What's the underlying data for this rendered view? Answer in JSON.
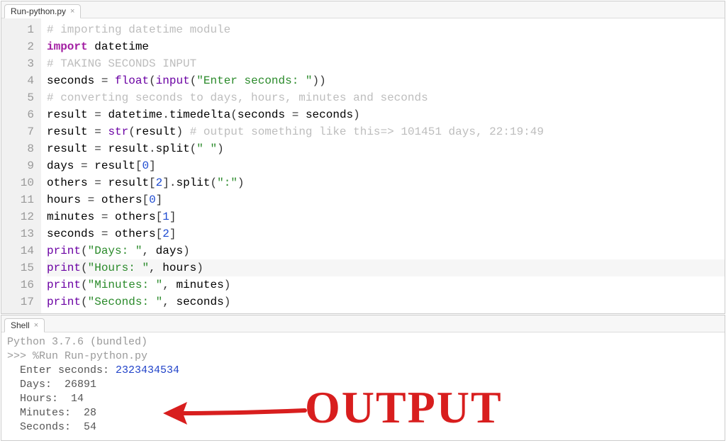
{
  "editor": {
    "tab_label": "Run-python.py",
    "tokens": [
      [
        [
          "comment",
          "# importing datetime module"
        ]
      ],
      [
        [
          "kw",
          "import"
        ],
        [
          "sp",
          " "
        ],
        [
          "id",
          "datetime"
        ]
      ],
      [
        [
          "comment",
          "# TAKING SECONDS INPUT"
        ]
      ],
      [
        [
          "id",
          "seconds"
        ],
        [
          "sp",
          " "
        ],
        [
          "op",
          "="
        ],
        [
          "sp",
          " "
        ],
        [
          "builtin",
          "float"
        ],
        [
          "op",
          "("
        ],
        [
          "builtin",
          "input"
        ],
        [
          "op",
          "("
        ],
        [
          "str",
          "\"Enter seconds: \""
        ],
        [
          "op",
          "))"
        ]
      ],
      [
        [
          "comment",
          "# converting seconds to days, hours, minutes and seconds"
        ]
      ],
      [
        [
          "id",
          "result"
        ],
        [
          "sp",
          " "
        ],
        [
          "op",
          "="
        ],
        [
          "sp",
          " "
        ],
        [
          "id",
          "datetime"
        ],
        [
          "op",
          "."
        ],
        [
          "id",
          "timedelta"
        ],
        [
          "op",
          "("
        ],
        [
          "id",
          "seconds"
        ],
        [
          "sp",
          " "
        ],
        [
          "op",
          "="
        ],
        [
          "sp",
          " "
        ],
        [
          "id",
          "seconds"
        ],
        [
          "op",
          ")"
        ]
      ],
      [
        [
          "id",
          "result"
        ],
        [
          "sp",
          " "
        ],
        [
          "op",
          "="
        ],
        [
          "sp",
          " "
        ],
        [
          "builtin",
          "str"
        ],
        [
          "op",
          "("
        ],
        [
          "id",
          "result"
        ],
        [
          "op",
          ")"
        ],
        [
          "sp",
          " "
        ],
        [
          "comment",
          "# output something like this=> 101451 days, 22:19:49"
        ]
      ],
      [
        [
          "id",
          "result"
        ],
        [
          "sp",
          " "
        ],
        [
          "op",
          "="
        ],
        [
          "sp",
          " "
        ],
        [
          "id",
          "result"
        ],
        [
          "op",
          "."
        ],
        [
          "id",
          "split"
        ],
        [
          "op",
          "("
        ],
        [
          "str",
          "\" \""
        ],
        [
          "op",
          ")"
        ]
      ],
      [
        [
          "id",
          "days"
        ],
        [
          "sp",
          " "
        ],
        [
          "op",
          "="
        ],
        [
          "sp",
          " "
        ],
        [
          "id",
          "result"
        ],
        [
          "op",
          "["
        ],
        [
          "num",
          "0"
        ],
        [
          "op",
          "]"
        ]
      ],
      [
        [
          "id",
          "others"
        ],
        [
          "sp",
          " "
        ],
        [
          "op",
          "="
        ],
        [
          "sp",
          " "
        ],
        [
          "id",
          "result"
        ],
        [
          "op",
          "["
        ],
        [
          "num",
          "2"
        ],
        [
          "op",
          "]"
        ],
        [
          "op",
          "."
        ],
        [
          "id",
          "split"
        ],
        [
          "op",
          "("
        ],
        [
          "str",
          "\":\""
        ],
        [
          "op",
          ")"
        ]
      ],
      [
        [
          "id",
          "hours"
        ],
        [
          "sp",
          " "
        ],
        [
          "op",
          "="
        ],
        [
          "sp",
          " "
        ],
        [
          "id",
          "others"
        ],
        [
          "op",
          "["
        ],
        [
          "num",
          "0"
        ],
        [
          "op",
          "]"
        ]
      ],
      [
        [
          "id",
          "minutes"
        ],
        [
          "sp",
          " "
        ],
        [
          "op",
          "="
        ],
        [
          "sp",
          " "
        ],
        [
          "id",
          "others"
        ],
        [
          "op",
          "["
        ],
        [
          "num",
          "1"
        ],
        [
          "op",
          "]"
        ]
      ],
      [
        [
          "id",
          "seconds"
        ],
        [
          "sp",
          " "
        ],
        [
          "op",
          "="
        ],
        [
          "sp",
          " "
        ],
        [
          "id",
          "others"
        ],
        [
          "op",
          "["
        ],
        [
          "num",
          "2"
        ],
        [
          "op",
          "]"
        ]
      ],
      [
        [
          "builtin",
          "print"
        ],
        [
          "op",
          "("
        ],
        [
          "str",
          "\"Days: \""
        ],
        [
          "op",
          ","
        ],
        [
          "sp",
          " "
        ],
        [
          "id",
          "days"
        ],
        [
          "op",
          ")"
        ]
      ],
      [
        [
          "builtin",
          "print"
        ],
        [
          "op",
          "("
        ],
        [
          "str",
          "\"Hours: \""
        ],
        [
          "op",
          ","
        ],
        [
          "sp",
          " "
        ],
        [
          "id",
          "hours"
        ],
        [
          "op",
          ")"
        ]
      ],
      [
        [
          "builtin",
          "print"
        ],
        [
          "op",
          "("
        ],
        [
          "str",
          "\"Minutes: \""
        ],
        [
          "op",
          ","
        ],
        [
          "sp",
          " "
        ],
        [
          "id",
          "minutes"
        ],
        [
          "op",
          ")"
        ]
      ],
      [
        [
          "builtin",
          "print"
        ],
        [
          "op",
          "("
        ],
        [
          "str",
          "\"Seconds: \""
        ],
        [
          "op",
          ","
        ],
        [
          "sp",
          " "
        ],
        [
          "id",
          "seconds"
        ],
        [
          "op",
          ")"
        ]
      ]
    ],
    "highlight_line": 15
  },
  "shell": {
    "tab_label": "Shell",
    "version_line": "Python 3.7.6 (bundled)",
    "prompt": ">>> ",
    "run_command": "%Run Run-python.py",
    "input_prompt": "  Enter seconds: ",
    "input_value": "2323434534",
    "output_lines": [
      "  Days:  26891",
      "  Hours:  14",
      "  Minutes:  28",
      "  Seconds:  54"
    ]
  },
  "annotation": {
    "text": "OUTPUT"
  }
}
